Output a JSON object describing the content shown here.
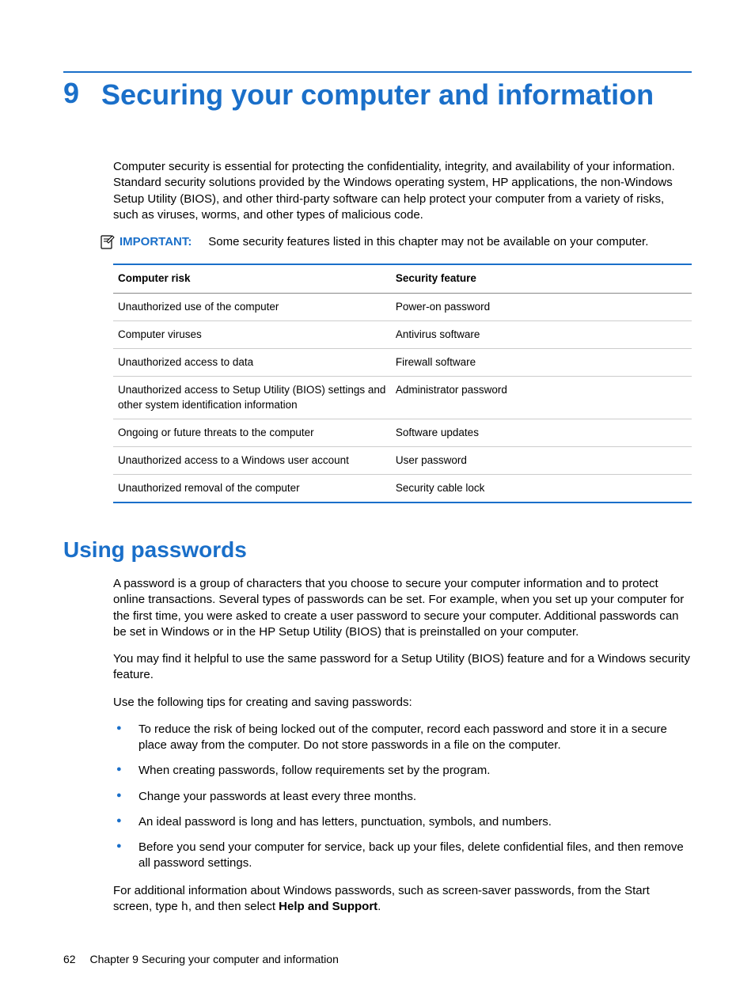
{
  "chapter": {
    "number": "9",
    "title": "Securing your computer and information"
  },
  "intro": "Computer security is essential for protecting the confidentiality, integrity, and availability of your information. Standard security solutions provided by the Windows operating system, HP applications, the non-Windows Setup Utility (BIOS), and other third-party software can help protect your computer from a variety of risks, such as viruses, worms, and other types of malicious code.",
  "important": {
    "label": "IMPORTANT:",
    "text": "Some security features listed in this chapter may not be available on your computer."
  },
  "table": {
    "headers": {
      "risk": "Computer risk",
      "feature": "Security feature"
    },
    "rows": [
      {
        "risk": "Unauthorized use of the computer",
        "feature": "Power-on password"
      },
      {
        "risk": "Computer viruses",
        "feature": "Antivirus software"
      },
      {
        "risk": "Unauthorized access to data",
        "feature": "Firewall software"
      },
      {
        "risk": "Unauthorized access to Setup Utility (BIOS) settings and other system identification information",
        "feature": "Administrator password"
      },
      {
        "risk": "Ongoing or future threats to the computer",
        "feature": "Software updates"
      },
      {
        "risk": "Unauthorized access to a Windows user account",
        "feature": "User password"
      },
      {
        "risk": "Unauthorized removal of the computer",
        "feature": "Security cable lock"
      }
    ]
  },
  "section": {
    "title": "Using passwords",
    "p1": "A password is a group of characters that you choose to secure your computer information and to protect online transactions. Several types of passwords can be set. For example, when you set up your computer for the first time, you were asked to create a user password to secure your computer. Additional passwords can be set in Windows or in the HP Setup Utility (BIOS) that is preinstalled on your computer.",
    "p2": "You may find it helpful to use the same password for a Setup Utility (BIOS) feature and for a Windows security feature.",
    "p3": "Use the following tips for creating and saving passwords:",
    "tips": [
      "To reduce the risk of being locked out of the computer, record each password and store it in a secure place away from the computer. Do not store passwords in a file on the computer.",
      "When creating passwords, follow requirements set by the program.",
      "Change your passwords at least every three months.",
      "An ideal password is long and has letters, punctuation, symbols, and numbers.",
      "Before you send your computer for service, back up your files, delete confidential files, and then remove all password settings."
    ],
    "p4_pre": "For additional information about Windows passwords, such as screen-saver passwords, from the Start screen, type ",
    "p4_code": "h",
    "p4_mid": ", and then select ",
    "p4_bold": "Help and Support",
    "p4_post": "."
  },
  "footer": {
    "page": "62",
    "text": "Chapter 9   Securing your computer and information"
  }
}
